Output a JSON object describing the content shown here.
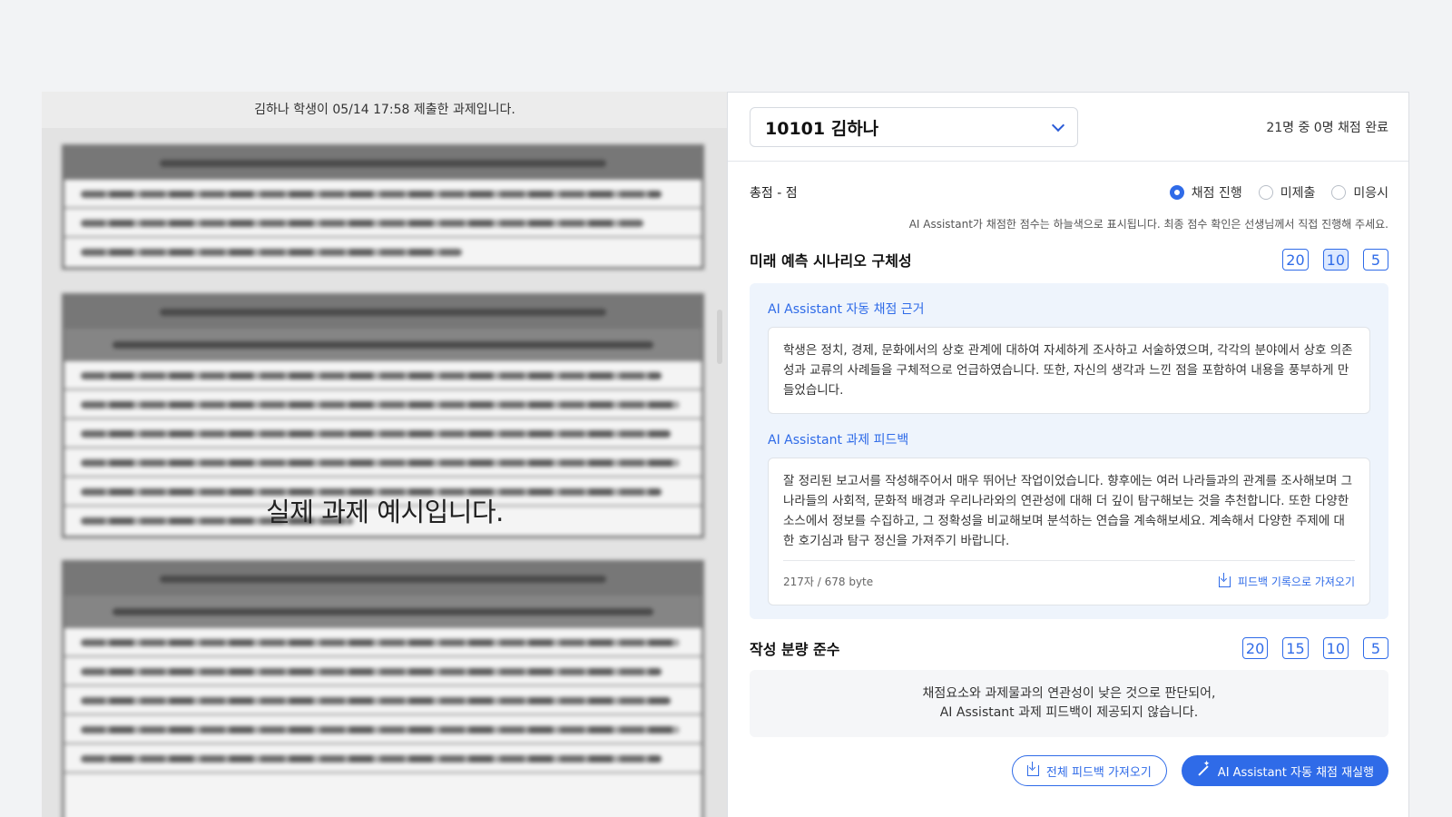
{
  "viewer": {
    "caption": "김하나 학생이 05/14 17:58 제출한 과제입니다.",
    "overlay": "실제 과제 예시입니다."
  },
  "header": {
    "student": "10101 김하나",
    "progress": "21명 중 0명 채점 완료"
  },
  "total": {
    "label": "총점 - 점",
    "options": [
      {
        "label": "채점 진행",
        "selected": true
      },
      {
        "label": "미제출",
        "selected": false
      },
      {
        "label": "미응시",
        "selected": false
      }
    ]
  },
  "notice": "AI Assistant가 채점한 점수는 하늘색으로 표시됩니다. 최종 점수 확인은 선생님께서 직접 진행해 주세요.",
  "criteria": [
    {
      "title": "미래 예측 시나리오 구체성",
      "scores": [
        "20",
        "10",
        "5"
      ],
      "selected": "10"
    },
    {
      "title": "작성 분량 준수",
      "scores": [
        "20",
        "15",
        "10",
        "5"
      ],
      "selected": ""
    }
  ],
  "ai": {
    "basis_label": "AI Assistant 자동 채점 근거",
    "basis_text": "학생은 정치, 경제, 문화에서의 상호 관계에 대하여 자세하게 조사하고 서술하였으며, 각각의 분야에서 상호 의존성과 교류의 사례들을 구체적으로 언급하였습니다. 또한, 자신의 생각과 느낀 점을 포함하여 내용을 풍부하게 만들었습니다.",
    "feedback_label": "AI Assistant 과제 피드백",
    "feedback_text": "잘 정리된 보고서를 작성해주어서 매우 뛰어난 작업이었습니다. 향후에는 여러 나라들과의 관계를 조사해보며 그 나라들의 사회적, 문화적 배경과 우리나라와의 연관성에 대해 더 깊이 탐구해보는 것을 추천합니다. 또한 다양한 소스에서 정보를 수집하고, 그 정확성을 비교해보며 분석하는 연습을 계속해보세요. 계속해서 다양한 주제에 대한 호기심과 탐구 정신을 가져주기 바랍니다.",
    "char_count": "217자 / 678 byte",
    "import_label": "피드백 기록으로 가져오기"
  },
  "no_feedback": {
    "line1": "채점요소와 과제물과의 연관성이 낮은 것으로 판단되어,",
    "line2": "AI Assistant 과제 피드백이 제공되지 않습니다."
  },
  "buttons": {
    "import_all": "전체 피드백 가져오기",
    "rerun": "AI Assistant 자동 채점 재실행"
  },
  "colors": {
    "accent": "#2f6be8",
    "selected_chip": "#dbe8ff",
    "ai_box": "#eef4fc"
  }
}
